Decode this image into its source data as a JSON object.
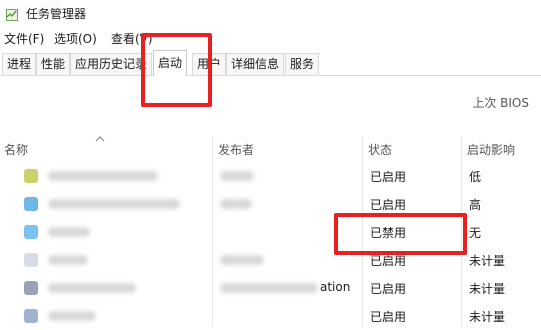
{
  "window": {
    "title": "任务管理器"
  },
  "menu": [
    "文件(F)",
    "选项(O)",
    "查看(V)"
  ],
  "tabs": [
    "进程",
    "性能",
    "应用历史记录",
    "启动",
    "用户",
    "详细信息",
    "服务"
  ],
  "active_tab": "启动",
  "bios_label": "上次 BIOS",
  "columns": {
    "name": "名称",
    "publisher": "发布者",
    "status": "状态",
    "impact": "启动影响"
  },
  "rows": [
    {
      "status": "已启用",
      "impact": "低",
      "icon_color": "#c9d36a"
    },
    {
      "status": "已启用",
      "impact": "高",
      "icon_color": "#6fb7e8"
    },
    {
      "status": "已禁用",
      "impact": "无",
      "icon_color": "#7cc2f0"
    },
    {
      "status": "已启用",
      "impact": "未计量",
      "icon_color": "#d9dbe6"
    },
    {
      "status": "已启用",
      "impact": "未计量",
      "publisher_visible": "ation",
      "icon_color": "#9aa3b5"
    },
    {
      "status": "已启用",
      "impact": "未计量",
      "icon_color": "#9fb3cf"
    }
  ],
  "highlight_color": "#e8201f"
}
